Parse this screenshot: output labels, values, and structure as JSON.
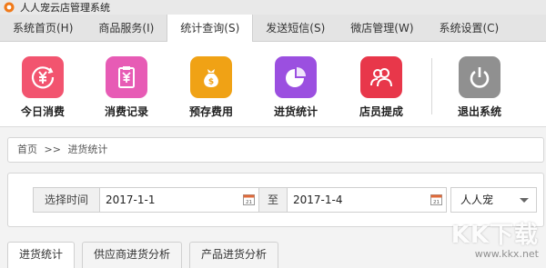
{
  "window": {
    "title": "人人宠云店管理系统"
  },
  "menu": {
    "tabs": [
      {
        "label": "系统首页(H)"
      },
      {
        "label": "商品服务(I)"
      },
      {
        "label": "统计查询(S)"
      },
      {
        "label": "发送短信(S)"
      },
      {
        "label": "微店管理(W)"
      },
      {
        "label": "系统设置(C)"
      }
    ],
    "active_index": 2
  },
  "toolbar": {
    "items": [
      {
        "label": "今日消费",
        "icon": "yen-circle-icon",
        "color": "#f2546f"
      },
      {
        "label": "消费记录",
        "icon": "receipt-icon",
        "color": "#e75bb5"
      },
      {
        "label": "预存费用",
        "icon": "money-bag-icon",
        "color": "#f0a215"
      },
      {
        "label": "进货统计",
        "icon": "pie-chart-icon",
        "color": "#9b4fe0"
      },
      {
        "label": "店员提成",
        "icon": "users-icon",
        "color": "#e8374a"
      },
      {
        "label": "退出系统",
        "icon": "power-icon",
        "color": "#909090"
      }
    ]
  },
  "breadcrumb": {
    "home": "首页",
    "separator": ">>",
    "current": "进货统计"
  },
  "filter": {
    "time_label": "选择时间",
    "start_date": "2017-1-1",
    "to_label": "至",
    "end_date": "2017-1-4",
    "store_selected": "人人宠"
  },
  "subtabs": [
    {
      "label": "进货统计"
    },
    {
      "label": "供应商进货分析"
    },
    {
      "label": "产品进货分析"
    }
  ],
  "watermark": {
    "logo": "KK下载",
    "url": "www.kkx.net"
  }
}
